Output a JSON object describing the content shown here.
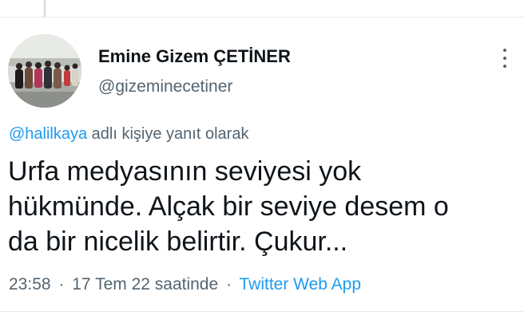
{
  "tweet": {
    "author": {
      "display_name": "Emine Gizem ÇETİNER",
      "handle": "@gizeminecetiner",
      "avatar": "group-photo-avatar"
    },
    "reply_context": {
      "mention": "@halilkaya",
      "suffix": " adlı kişiye yanıt olarak"
    },
    "text_lines": [
      "Urfa medyasının seviyesi yok",
      "hükmünde. Alçak bir seviye desem o",
      "da bir nicelik belirtir. Çukur..."
    ],
    "meta": {
      "time": "23:58",
      "separator": "·",
      "date": "17 Tem 22 saatinde",
      "source": "Twitter Web App"
    },
    "more_icon": "more-vertical-icon"
  },
  "colors": {
    "text": "#0f1419",
    "secondary": "#536471",
    "accent": "#1d9bf0",
    "divider": "#e7ebee"
  }
}
